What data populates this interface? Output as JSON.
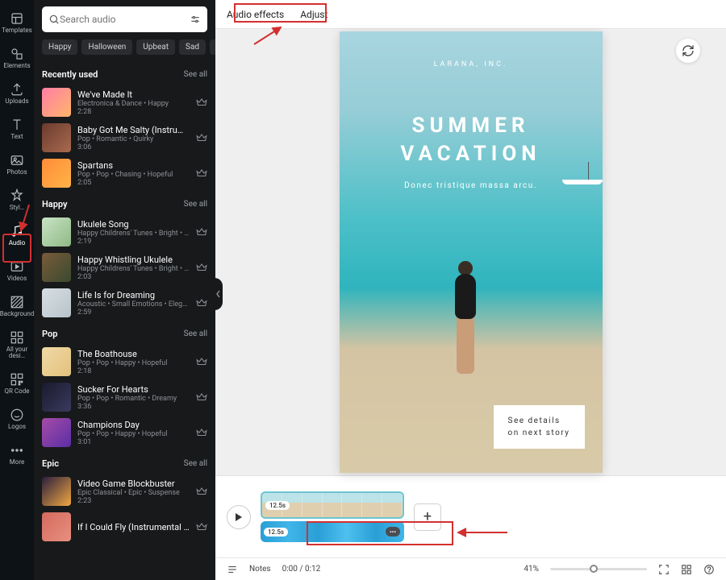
{
  "rail": [
    {
      "label": "Templates",
      "icon": "templates"
    },
    {
      "label": "Elements",
      "icon": "elements"
    },
    {
      "label": "Uploads",
      "icon": "uploads"
    },
    {
      "label": "Text",
      "icon": "text"
    },
    {
      "label": "Photos",
      "icon": "photos"
    },
    {
      "label": "Styl…",
      "icon": "styles"
    },
    {
      "label": "Audio",
      "icon": "audio",
      "active": true
    },
    {
      "label": "Videos",
      "icon": "videos"
    },
    {
      "label": "Background",
      "icon": "background"
    },
    {
      "label": "All your desi…",
      "icon": "folder"
    },
    {
      "label": "QR Code",
      "icon": "qrcode"
    },
    {
      "label": "Logos",
      "icon": "logos"
    },
    {
      "label": "More",
      "icon": "more"
    }
  ],
  "search": {
    "placeholder": "Search audio"
  },
  "chips": [
    "Happy",
    "Halloween",
    "Upbeat",
    "Sad",
    "P"
  ],
  "see_all": "See all",
  "sections": [
    {
      "title": "Recently used",
      "items": [
        {
          "title": "We've Made It",
          "sub": "Electronica & Dance • Happy",
          "dur": "2:28",
          "thumb": "linear-gradient(135deg,#ff7ea5,#ffb56b)"
        },
        {
          "title": "Baby Got Me Salty (Instrumental …",
          "sub": "Pop • Romantic • Quirky",
          "dur": "3:06",
          "thumb": "linear-gradient(135deg,#6b3a2e,#a86b4f)"
        },
        {
          "title": "Spartans",
          "sub": "Pop • Pop • Chasing • Hopeful",
          "dur": "2:05",
          "thumb": "linear-gradient(135deg,#ff8c3a,#ffb347)"
        }
      ]
    },
    {
      "title": "Happy",
      "items": [
        {
          "title": "Ukulele Song",
          "sub": "Happy Childrens' Tunes • Bright • …",
          "dur": "2:19",
          "thumb": "linear-gradient(135deg,#c9e4c5,#8fb985)"
        },
        {
          "title": "Happy Whistling Ukulele",
          "sub": "Happy Childrens' Tunes • Bright • …",
          "dur": "2:03",
          "thumb": "linear-gradient(135deg,#7a5b3a,#3a4a2f)"
        },
        {
          "title": "Life Is for Dreaming",
          "sub": "Acoustic • Small Emotions • Elegant • …",
          "dur": "2:59",
          "thumb": "linear-gradient(135deg,#d6dee3,#b8c4ca)"
        }
      ]
    },
    {
      "title": "Pop",
      "items": [
        {
          "title": "The Boathouse",
          "sub": "Pop • Pop • Happy • Hopeful",
          "dur": "2:18",
          "thumb": "linear-gradient(135deg,#f0d9a6,#e2c17c)"
        },
        {
          "title": "Sucker For Hearts",
          "sub": "Pop • Pop • Romantic • Dreamy",
          "dur": "3:36",
          "thumb": "linear-gradient(135deg,#1a1a2e,#3a3a5e)"
        },
        {
          "title": "Champions Day",
          "sub": "Pop • Pop • Happy • Hopeful",
          "dur": "3:01",
          "thumb": "linear-gradient(135deg,#a64ca6,#5a2ea6)"
        }
      ]
    },
    {
      "title": "Epic",
      "items": [
        {
          "title": "Video Game Blockbuster",
          "sub": "Epic Classical • Epic • Suspense",
          "dur": "2:23",
          "thumb": "linear-gradient(135deg,#2a1e3e,#f0a840)"
        },
        {
          "title": "If I Could Fly (Instrumental Versio…",
          "sub": "",
          "dur": "",
          "thumb": "linear-gradient(135deg,#d46a5e,#e89080)"
        }
      ]
    }
  ],
  "topbar": {
    "effects": "Audio effects",
    "adjust": "Adjust"
  },
  "canvas": {
    "brand": "LARANA, INC.",
    "headline1": "SUMMER",
    "headline2": "VACATION",
    "sub": "Donec tristique massa arcu.",
    "card1": "See details",
    "card2": "on next story"
  },
  "timeline": {
    "dur_video": "12.5s",
    "dur_audio": "12.5s"
  },
  "bottom": {
    "notes": "Notes",
    "time": "0:00 / 0:12",
    "zoom": "41%"
  }
}
